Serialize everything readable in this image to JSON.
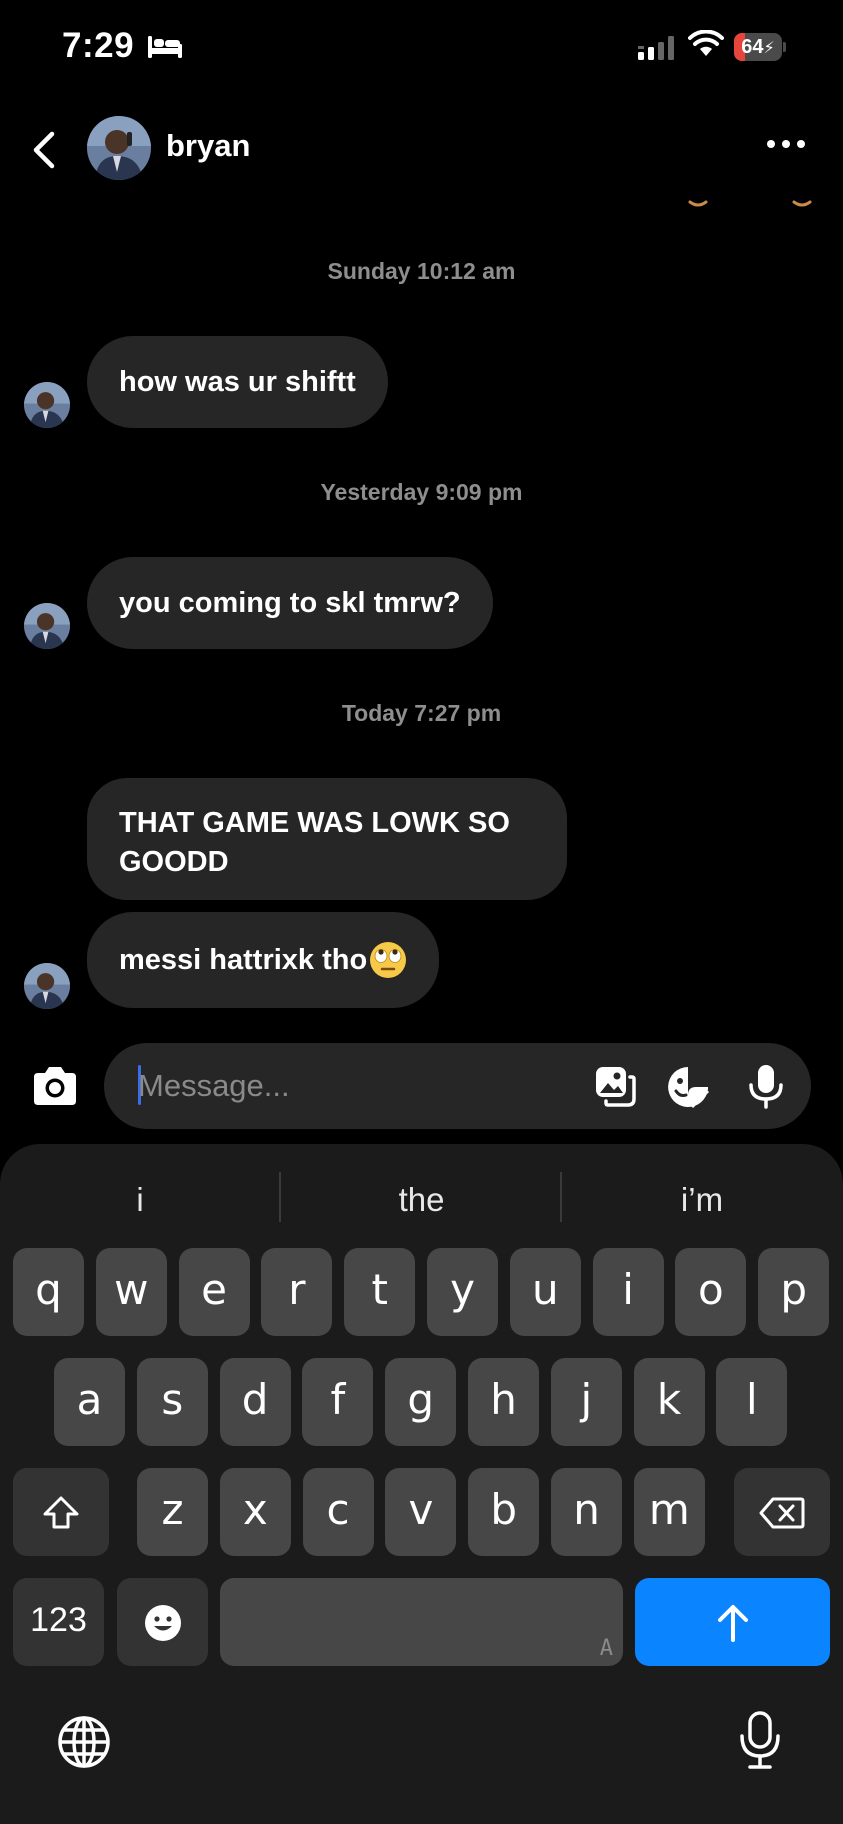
{
  "status_bar": {
    "time": "7:29",
    "battery": "64",
    "battery_level_percent": 64
  },
  "header": {
    "contact_name": "bryan"
  },
  "messages": [
    {
      "type": "timestamp",
      "text": "Sunday 10:12 am"
    },
    {
      "type": "incoming",
      "text": "how was ur shiftt"
    },
    {
      "type": "timestamp",
      "text": "Yesterday 9:09 pm"
    },
    {
      "type": "incoming",
      "text": "you coming to skl tmrw?"
    },
    {
      "type": "timestamp",
      "text": "Today 7:27 pm"
    },
    {
      "type": "incoming",
      "text": "THAT GAME WAS LOWK SO GOODD"
    },
    {
      "type": "incoming",
      "text": "messi hattrixk tho",
      "emoji": "face-with-rolling-eyes"
    }
  ],
  "composer": {
    "placeholder": "Message...",
    "value": ""
  },
  "keyboard": {
    "suggestions": [
      "i",
      "the",
      "i’m"
    ],
    "row1": [
      "q",
      "w",
      "e",
      "r",
      "t",
      "y",
      "u",
      "i",
      "o",
      "p"
    ],
    "row2": [
      "a",
      "s",
      "d",
      "f",
      "g",
      "h",
      "j",
      "k",
      "l"
    ],
    "row3": [
      "z",
      "x",
      "c",
      "v",
      "b",
      "n",
      "m"
    ],
    "numbers_key": "123",
    "space_hint": "A"
  },
  "colors": {
    "background": "#000000",
    "bubble": "#262626",
    "timestamp": "#8e8e8e",
    "send_key": "#0a84ff",
    "battery_low": "#e5453b"
  },
  "icons": [
    "bed-icon",
    "signal-icon",
    "wifi-icon",
    "back-icon",
    "more-icon",
    "camera-icon",
    "gallery-icon",
    "sticker-icon",
    "mic-icon",
    "shift-icon",
    "backspace-icon",
    "emoji-icon",
    "arrow-up-icon",
    "globe-icon",
    "dictation-mic-icon"
  ]
}
